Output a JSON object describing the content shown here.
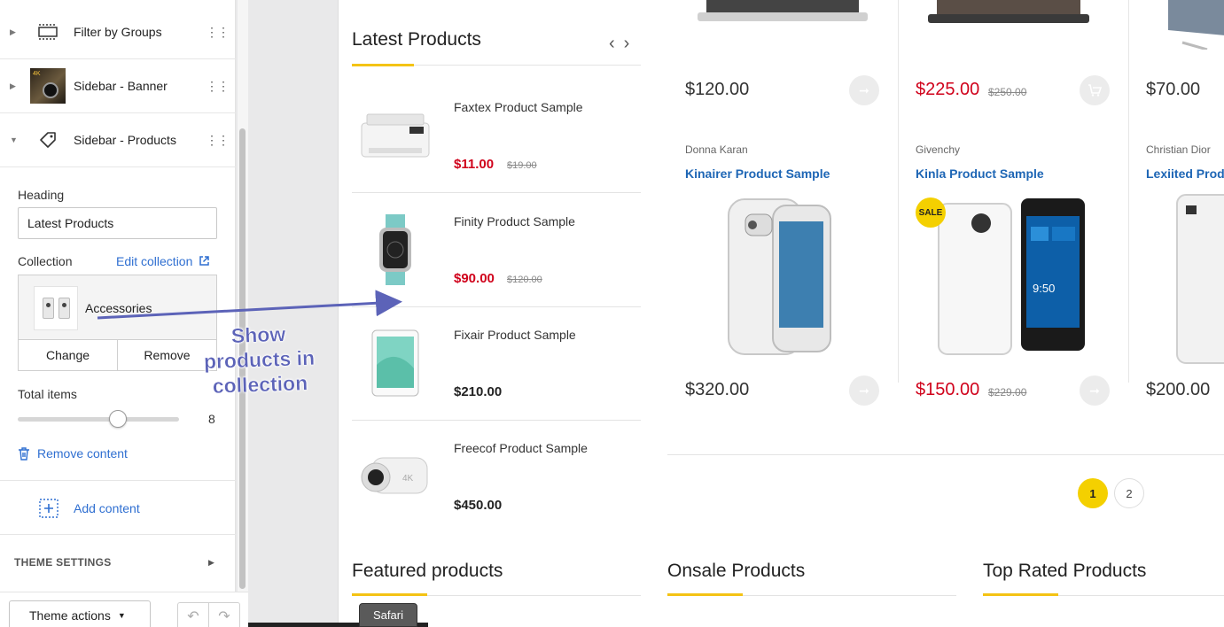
{
  "editor": {
    "sections": [
      {
        "label": "Filter by Groups",
        "icon": "filter-groups-icon"
      },
      {
        "label": "Sidebar - Banner",
        "icon": "banner-thumbnail",
        "thumb_text": "4K"
      },
      {
        "label": "Sidebar - Products",
        "icon": "tag-icon"
      }
    ],
    "heading_label": "Heading",
    "heading_value": "Latest Products",
    "collection_label": "Collection",
    "edit_collection": "Edit collection",
    "collection_name": "Accessories",
    "change": "Change",
    "remove": "Remove",
    "total_items_label": "Total items",
    "total_items_value": "8",
    "remove_content": "Remove content",
    "add_content": "Add content",
    "theme_settings": "THEME SETTINGS",
    "theme_actions": "Theme actions"
  },
  "annotation": {
    "text": "Show products in collection",
    "color": "#5c63b8"
  },
  "latest": {
    "title": "Latest Products",
    "items": [
      {
        "name": "Faxtex Product Sample",
        "price": "$11.00",
        "old_price": "$19.00",
        "on_sale": true,
        "image": "printer"
      },
      {
        "name": "Finity Product Sample",
        "price": "$90.00",
        "old_price": "$120.00",
        "on_sale": true,
        "image": "smartwatch"
      },
      {
        "name": "Fixair Product Sample",
        "price": "$210.00",
        "old_price": "",
        "on_sale": false,
        "image": "tablet"
      },
      {
        "name": "Freecof Product Sample",
        "price": "$450.00",
        "old_price": "",
        "on_sale": false,
        "image": "action-camera"
      }
    ]
  },
  "grid": {
    "row1": [
      {
        "price": "$120.00",
        "old_price": "",
        "sale": false
      },
      {
        "price": "$225.00",
        "old_price": "$250.00",
        "sale": true
      },
      {
        "price": "$70.00",
        "old_price": "",
        "sale": false
      }
    ],
    "row2": [
      {
        "brand": "Donna Karan",
        "name": "Kinairer Product Sample",
        "price": "$320.00",
        "old_price": "",
        "sale": false
      },
      {
        "brand": "Givenchy",
        "name": "Kinla Product Sample",
        "price": "$150.00",
        "old_price": "$229.00",
        "sale": true,
        "badge": "SALE"
      },
      {
        "brand": "Christian Dior",
        "name": "Lexiited Produ",
        "price": "$200.00",
        "old_price": "",
        "sale": false
      }
    ],
    "pages": [
      "1",
      "2"
    ]
  },
  "bottom_sections": [
    "Featured products",
    "Onsale Products",
    "Top Rated Products"
  ],
  "tooltip": "Safari",
  "colors": {
    "accent_yellow": "#f4c314",
    "sale_red": "#d0021b",
    "link_blue": "#2f6fd1",
    "product_link": "#1e66b5"
  }
}
